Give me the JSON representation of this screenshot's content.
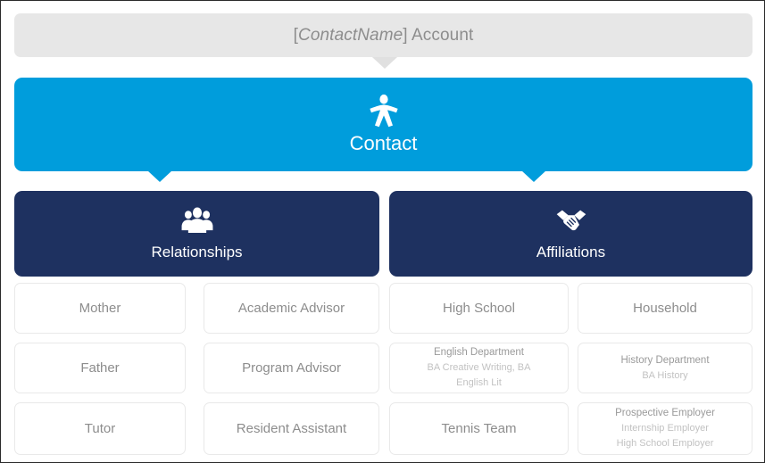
{
  "header": {
    "prefix": "[",
    "contact_name": "ContactName",
    "suffix": "] Account"
  },
  "contact": {
    "label": "Contact",
    "icon": "person-icon"
  },
  "colors": {
    "accent_blue": "#009ddc",
    "navy": "#1e3160",
    "header_gray": "#e7e7e7",
    "card_border": "#e9e9e9",
    "text_gray": "#8d8d8d",
    "subtext_gray": "#c2c2c2"
  },
  "categories": [
    {
      "label": "Relationships",
      "icon": "people-group-icon",
      "columns": [
        {
          "cards": [
            {
              "title": "Mother",
              "subs": []
            },
            {
              "title": "Father",
              "subs": []
            },
            {
              "title": "Tutor",
              "subs": []
            }
          ]
        },
        {
          "cards": [
            {
              "title": "Academic Advisor",
              "subs": []
            },
            {
              "title": "Program Advisor",
              "subs": []
            },
            {
              "title": "Resident Assistant",
              "subs": []
            }
          ]
        }
      ]
    },
    {
      "label": "Affiliations",
      "icon": "handshake-icon",
      "columns": [
        {
          "cards": [
            {
              "title": "High School",
              "subs": []
            },
            {
              "title": "English Department",
              "subs": [
                "BA Creative Writing, BA",
                "English Lit"
              ]
            },
            {
              "title": "Tennis Team",
              "subs": []
            }
          ]
        },
        {
          "cards": [
            {
              "title": "Household",
              "subs": []
            },
            {
              "title": "History Department",
              "subs": [
                "BA History"
              ]
            },
            {
              "title": "Prospective Employer",
              "subs": [
                "Internship Employer",
                "High School Employer"
              ]
            }
          ]
        }
      ]
    }
  ]
}
